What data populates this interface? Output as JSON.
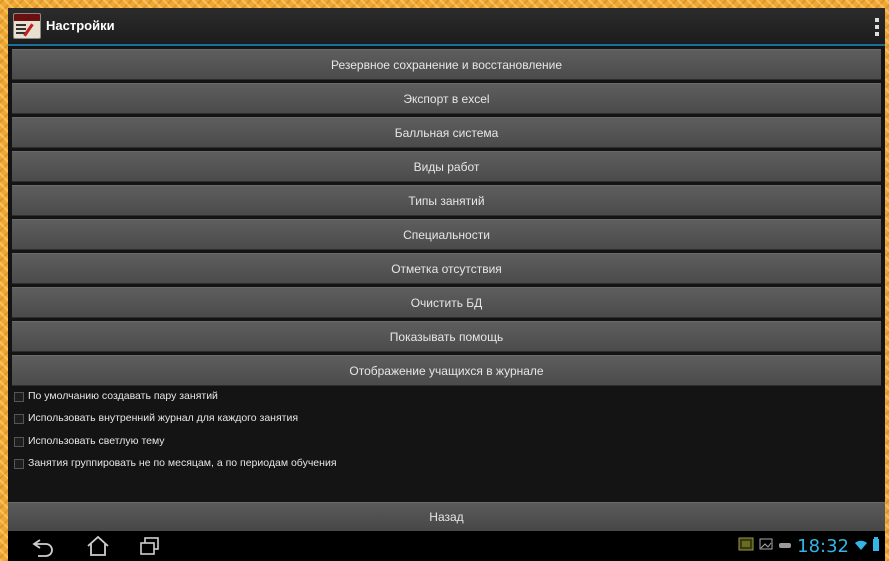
{
  "header": {
    "title": "Настройки"
  },
  "buttons": [
    "Резервное сохранение и восстановление",
    "Экспорт в excel",
    "Балльная система",
    "Виды работ",
    "Типы занятий",
    "Специальности",
    "Отметка отсутствия",
    "Очистить БД",
    "Показывать помощь",
    "Отображение учащихся в журнале"
  ],
  "checkboxes": [
    {
      "label": "По умолчанию создавать пару занятий",
      "checked": false
    },
    {
      "label": "Использовать внутренний журнал для каждого занятия",
      "checked": false
    },
    {
      "label": "Использовать светлую тему",
      "checked": false
    },
    {
      "label": "Занятия группировать не по месяцам, а по периодам обучения",
      "checked": false
    }
  ],
  "back_label": "Назад",
  "status": {
    "time": "18:32"
  },
  "icons": {
    "app": "app-logo-icon",
    "overflow": "overflow-menu-icon",
    "nav": [
      "back-icon",
      "home-icon",
      "recent-apps-icon"
    ],
    "status": [
      "screenshot-icon",
      "gallery-icon",
      "usb-icon",
      "wifi-icon",
      "battery-icon"
    ]
  },
  "colors": {
    "accent": "#33b5e5",
    "actionbar_border": "#1b6f96",
    "button": "#555555"
  }
}
